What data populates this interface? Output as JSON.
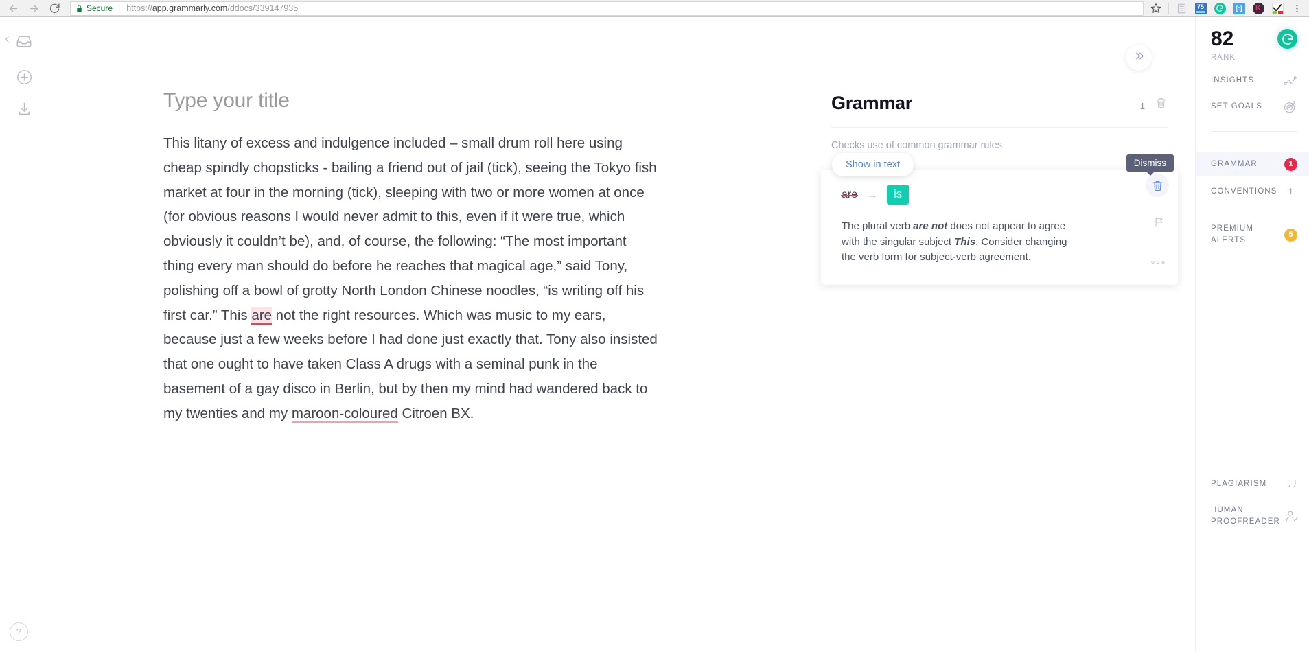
{
  "browser": {
    "security_label": "Secure",
    "url_scheme": "https://",
    "url_host": "app.grammarly.com",
    "url_path": "/ddocs/339147935",
    "back_icon": "back-arrow-icon",
    "forward_icon": "forward-arrow-icon",
    "reload_icon": "reload-icon",
    "lock_icon": "lock-icon",
    "star_icon": "bookmark-star-icon",
    "menu_icon": "chrome-menu-icon",
    "extensions": [
      {
        "name": "reading-list-extension",
        "label": "",
        "color": "#c9ccd4"
      },
      {
        "name": "score-75-extension",
        "label": "75",
        "color": "#3b74c4"
      },
      {
        "name": "grammarly-extension",
        "label": "G",
        "color": "#11c39c"
      },
      {
        "name": "blue-tag-extension",
        "label": "",
        "color": "#4aa3ef"
      },
      {
        "name": "kaspersky-extension",
        "label": "K",
        "color": "#3a2a3f"
      },
      {
        "name": "checkmark-extension",
        "label": "",
        "color": "#ffffff"
      }
    ]
  },
  "left_rail": {
    "back_icon": "back-chevron-icon",
    "inbox_icon": "inbox-tray-icon",
    "add_icon": "plus-circle-icon",
    "download_icon": "download-icon",
    "help_label": "?"
  },
  "collapse_button": {
    "icon": "double-chevron-right-icon"
  },
  "document": {
    "title_placeholder": "Type your title",
    "paragraph_parts": [
      "This litany of excess and indulgence included – small drum roll here using cheap spindly chopsticks - bailing a friend out of jail (tick), seeing the Tokyo fish market at four in the morning (tick), sleeping with two or more women at once (for obvious reasons I would never admit to this, even if it were true, which obviously it couldn’t be), and, of course, the following: “The most important thing every man should do before he reaches that magical age,” said Tony, polishing off a bowl of grotty North London Chinese noodles, “is writing off his first car.” This ",
      "are",
      " not the right resources.  Which was music to my ears, because just a few weeks before I had done just exactly that. Tony also insisted that one ought to have taken Class A drugs with a seminal punk in the basement of a gay disco in Berlin, but by then my mind had wandered back to my twenties and my ",
      "maroon-coloured",
      " Citroen BX."
    ],
    "grammar_highlight": "are",
    "premium_highlight": "maroon-coloured"
  },
  "assistant": {
    "category_title": "Grammar",
    "category_count": "1",
    "clear_icon": "trash-icon",
    "category_description": "Checks use of common grammar rules",
    "card": {
      "show_in_text_label": "Show in text",
      "original_word": "are",
      "arrow": "→",
      "replacement_word": "is",
      "explanation_prefix": "The plural verb ",
      "explanation_bold_1": "are not",
      "explanation_middle": " does not appear to agree with the singular subject ",
      "explanation_bold_2": "This",
      "explanation_suffix": ". Consider changing the verb form for subject-verb agreement.",
      "dismiss_tooltip": "Dismiss",
      "dismiss_icon": "trash-icon",
      "flag_icon": "flag-icon",
      "more_icon": "more-options-icon"
    }
  },
  "sidebar": {
    "score_value": "82",
    "score_label": "RANK",
    "logo_letter": "G",
    "logo_color": "#11c39c",
    "rows": [
      {
        "label": "INSIGHTS",
        "icon": "line-chart-icon"
      },
      {
        "label": "SET GOALS",
        "icon": "target-icon"
      }
    ],
    "grammar": {
      "label": "GRAMMAR",
      "badge": "1",
      "badge_color": "#e8294a"
    },
    "conventions": {
      "label": "CONVENTIONS",
      "badge": "1"
    },
    "premium": {
      "label": "PREMIUM ALERTS",
      "label_line1": "PREMIUM",
      "label_line2": "ALERTS",
      "badge": "5",
      "badge_color": "#f5b731"
    },
    "plagiarism": {
      "label": "PLAGIARISM",
      "icon": "quotation-mark-icon"
    },
    "proofreader": {
      "label_line1": "HUMAN",
      "label_line2": "PROOFREADER",
      "icon": "person-check-icon"
    }
  }
}
